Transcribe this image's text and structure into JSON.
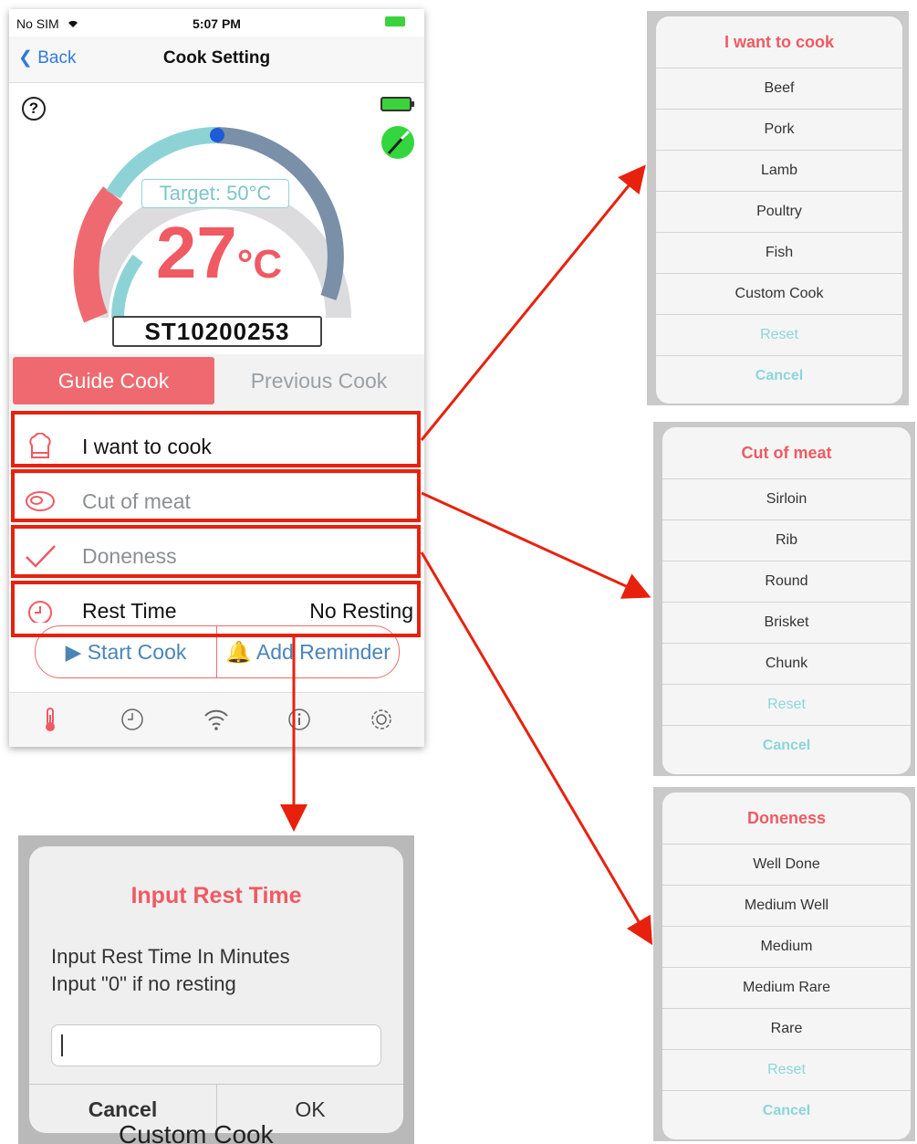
{
  "status_bar": {
    "carrier": "No SIM",
    "time": "5:07 PM"
  },
  "nav": {
    "back_label": "Back",
    "title": "Cook Setting"
  },
  "gauge": {
    "target_label": "Target: 50°C",
    "temperature": "27",
    "unit": "°C",
    "serial": "ST10200253"
  },
  "tabs": {
    "active": "Guide Cook",
    "inactive": "Previous Cook"
  },
  "settings_rows": [
    {
      "label": "I want to cook",
      "value": ""
    },
    {
      "label": "Cut of meat",
      "value": ""
    },
    {
      "label": "Doneness",
      "value": ""
    },
    {
      "label": "Rest Time",
      "value": "No Resting"
    }
  ],
  "actions": {
    "start": "Start Cook",
    "reminder": "Add Reminder"
  },
  "tabbar_icons": [
    "thermometer-icon",
    "clock-icon",
    "wifi-icon",
    "info-icon",
    "gear-icon"
  ],
  "picker_cook": {
    "title": "I want to cook",
    "items": [
      "Beef",
      "Pork",
      "Lamb",
      "Poultry",
      "Fish",
      "Custom Cook"
    ],
    "reset": "Reset",
    "cancel": "Cancel"
  },
  "picker_cut": {
    "title": "Cut of meat",
    "items": [
      "Sirloin",
      "Rib",
      "Round",
      "Brisket",
      "Chunk"
    ],
    "reset": "Reset",
    "cancel": "Cancel"
  },
  "picker_doneness": {
    "title": "Doneness",
    "items": [
      "Well Done",
      "Medium Well",
      "Medium",
      "Medium Rare",
      "Rare"
    ],
    "reset": "Reset",
    "cancel": "Cancel"
  },
  "rest_dialog": {
    "title": "Input Rest Time",
    "message_line1": "Input Rest Time In Minutes",
    "message_line2": "Input \"0\" if no resting",
    "input_value": "",
    "cancel": "Cancel",
    "ok": "OK",
    "background_text": "Custom Cook"
  },
  "colors": {
    "accent_red": "#ef5a63",
    "teal": "#8bd6da",
    "steel_blue": "#7a8fa8",
    "highlight": "#e8210e"
  }
}
